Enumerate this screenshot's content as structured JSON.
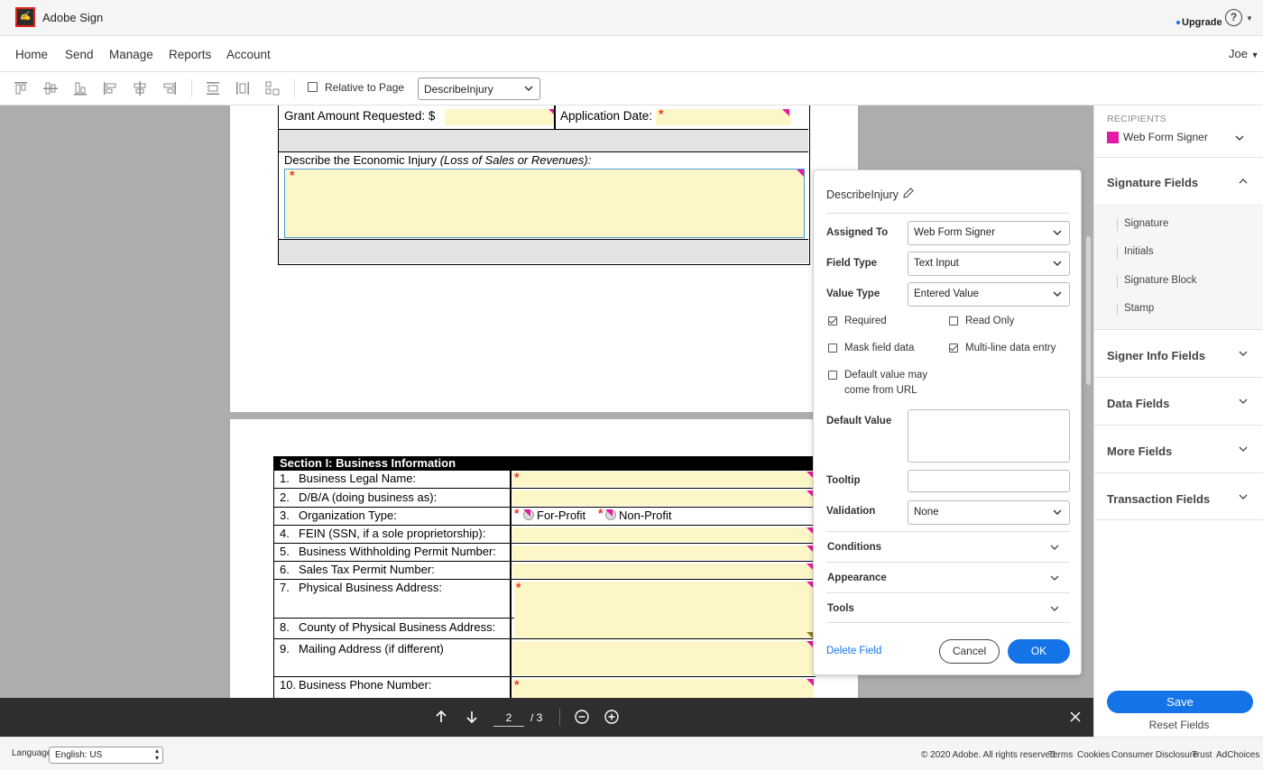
{
  "topbar": {
    "app_title": "Adobe Sign",
    "upgrade": "Upgrade",
    "help": "?"
  },
  "nav": {
    "items": [
      "Home",
      "Send",
      "Manage",
      "Reports",
      "Account"
    ],
    "user": "Joe"
  },
  "toolbar": {
    "icons": [
      "align-top-icon",
      "align-middle-icon",
      "align-bottom-icon",
      "align-left-icon",
      "align-center-icon",
      "align-right-icon",
      "distribute-vertical-icon",
      "distribute-horizontal-icon",
      "match-size-icon"
    ],
    "relative_to_page": "Relative to Page",
    "field_select": "DescribeInjury"
  },
  "document": {
    "page1": {
      "grant_amount": "Grant Amount Requested: $",
      "application_date": "Application Date:",
      "describe_label": "Describe the Economic Injury",
      "describe_italic": "(Loss of Sales or Revenues):"
    },
    "page2": {
      "section_header": "Section I: Business Information",
      "rows": [
        {
          "num": "1.",
          "label": "Business Legal Name:"
        },
        {
          "num": "2.",
          "label": "D/B/A (doing business as):"
        },
        {
          "num": "3.",
          "label": "Organization Type:"
        },
        {
          "num": "4.",
          "label": "FEIN (SSN, if a sole proprietorship):"
        },
        {
          "num": "5.",
          "label": "Business Withholding Permit Number:"
        },
        {
          "num": "6.",
          "label": "Sales Tax Permit Number:"
        },
        {
          "num": "7.",
          "label": "Physical Business Address:"
        },
        {
          "num": "8.",
          "label": "County of Physical Business Address:"
        },
        {
          "num": "9.",
          "label": "Mailing Address (if different)"
        },
        {
          "num": "10.",
          "label": "Business Phone Number:"
        }
      ],
      "for_profit": "For-Profit",
      "non_profit": "Non-Profit"
    }
  },
  "popup": {
    "title": "DescribeInjury",
    "assigned_to_label": "Assigned To",
    "assigned_to_value": "Web Form Signer",
    "field_type_label": "Field Type",
    "field_type_value": "Text Input",
    "value_type_label": "Value Type",
    "value_type_value": "Entered Value",
    "checkboxes": {
      "required": {
        "label": "Required",
        "checked": true
      },
      "read_only": {
        "label": "Read Only",
        "checked": false
      },
      "mask": {
        "label": "Mask field data",
        "checked": false
      },
      "multiline": {
        "label": "Multi-line data entry",
        "checked": true
      },
      "default_url_line1": "Default value may",
      "default_url_line2": "come from URL",
      "default_url_checked": false
    },
    "default_value_label": "Default Value",
    "tooltip_label": "Tooltip",
    "validation_label": "Validation",
    "validation_value": "None",
    "accordions": [
      "Conditions",
      "Appearance",
      "Tools"
    ],
    "delete_field": "Delete Field",
    "cancel": "Cancel",
    "ok": "OK"
  },
  "sidebar": {
    "recipients_heading": "RECIPIENTS",
    "recipient": "Web Form Signer",
    "recipient_color": "#e619a5",
    "signature_fields": "Signature Fields",
    "signature_items": [
      "Signature",
      "Initials",
      "Signature Block",
      "Stamp"
    ],
    "sections": [
      "Signer Info Fields",
      "Data Fields",
      "More Fields",
      "Transaction Fields"
    ],
    "save": "Save",
    "reset": "Reset Fields"
  },
  "pager": {
    "current_page": "2",
    "total": "/ 3"
  },
  "footer": {
    "language_label": "Language",
    "language_value": "English: US",
    "copyright": "© 2020 Adobe. All rights reserved.",
    "links": [
      "Terms",
      "Cookies",
      "Consumer Disclosure",
      "Trust",
      "AdChoices"
    ]
  },
  "colors": {
    "accent": "#1473e6",
    "field_fill": "#fdf6c6",
    "required": "#e53b24",
    "signer": "#e619a5"
  }
}
